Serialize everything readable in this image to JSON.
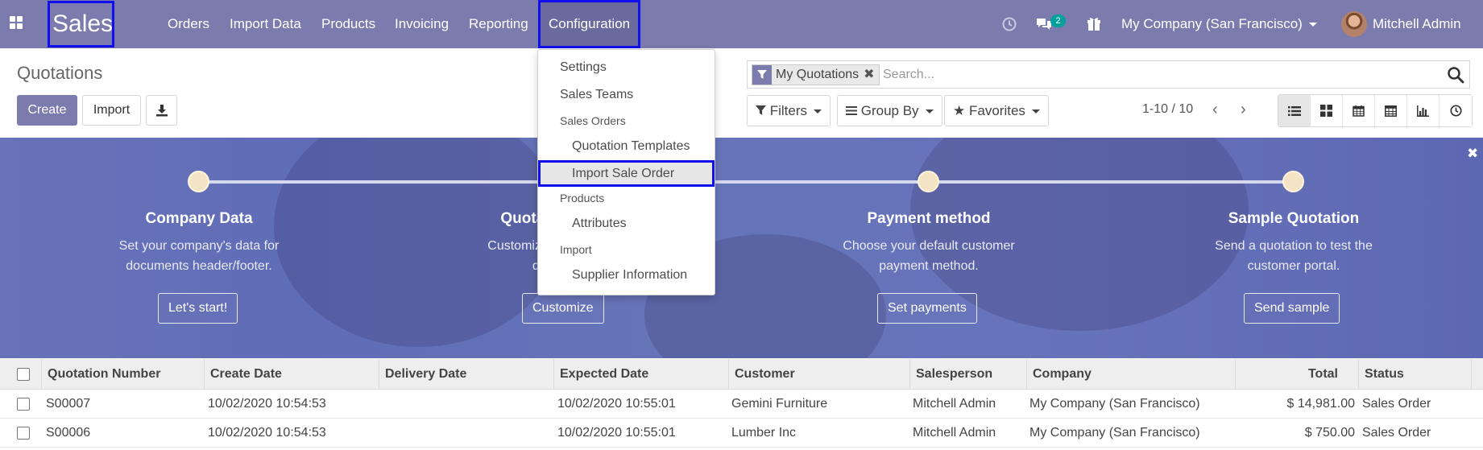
{
  "navbar": {
    "brand": "Sales",
    "menus": [
      "Orders",
      "Import Data",
      "Products",
      "Invoicing",
      "Reporting",
      "Configuration"
    ],
    "messages_count": "2",
    "company": "My Company (San Francisco)",
    "user": "Mitchell Admin"
  },
  "control_panel": {
    "title": "Quotations",
    "create_label": "Create",
    "import_label": "Import",
    "search": {
      "facet": "My Quotations",
      "placeholder": "Search..."
    },
    "filters_label": "Filters",
    "group_by_label": "Group By",
    "favorites_label": "Favorites",
    "pager": "1-10 / 10"
  },
  "onboarding": {
    "steps": [
      {
        "title": "Company Data",
        "desc1": "Set your company's data for",
        "desc2": "documents header/footer.",
        "button": "Let's start!"
      },
      {
        "title": "Quotation Layout",
        "desc1": "Customize the look of your",
        "desc2": "quotations.",
        "button": "Customize"
      },
      {
        "title": "Payment method",
        "desc1": "Choose your default customer",
        "desc2": "payment method.",
        "button": "Set payments"
      },
      {
        "title": "Sample Quotation",
        "desc1": "Send a quotation to test the",
        "desc2": "customer portal.",
        "button": "Send sample"
      }
    ]
  },
  "config_menu": {
    "settings": "Settings",
    "sales_teams": "Sales Teams",
    "sales_orders_header": "Sales Orders",
    "quotation_templates": "Quotation Templates",
    "import_sale_order": "Import Sale Order",
    "products_header": "Products",
    "attributes": "Attributes",
    "import_header": "Import",
    "supplier_information": "Supplier Information"
  },
  "table": {
    "columns": [
      "Quotation Number",
      "Create Date",
      "Delivery Date",
      "Expected Date",
      "Customer",
      "Salesperson",
      "Company",
      "Total",
      "Status"
    ],
    "rows": [
      {
        "number": "S00007",
        "create_date": "10/02/2020 10:54:53",
        "delivery_date": "",
        "expected_date": "10/02/2020 10:55:01",
        "customer": "Gemini Furniture",
        "salesperson": "Mitchell Admin",
        "company": "My Company (San Francisco)",
        "total": "$ 14,981.00",
        "status": "Sales Order"
      },
      {
        "number": "S00006",
        "create_date": "10/02/2020 10:54:53",
        "delivery_date": "",
        "expected_date": "10/02/2020 10:55:01",
        "customer": "Lumber Inc",
        "salesperson": "Mitchell Admin",
        "company": "My Company (San Francisco)",
        "total": "$ 750.00",
        "status": "Sales Order"
      }
    ]
  },
  "colors": {
    "brand": "#7c7bad",
    "highlight_border": "#1010ee",
    "banner": "#6a73b8"
  },
  "icons": [
    "apps-grid-icon",
    "clock-icon",
    "chat-icon",
    "gift-icon",
    "download-icon",
    "filter-icon",
    "search-icon",
    "bars-icon",
    "star-icon",
    "list-view-icon",
    "kanban-view-icon",
    "calendar-view-icon",
    "pivot-view-icon",
    "graph-view-icon",
    "activity-view-icon",
    "close-icon"
  ]
}
